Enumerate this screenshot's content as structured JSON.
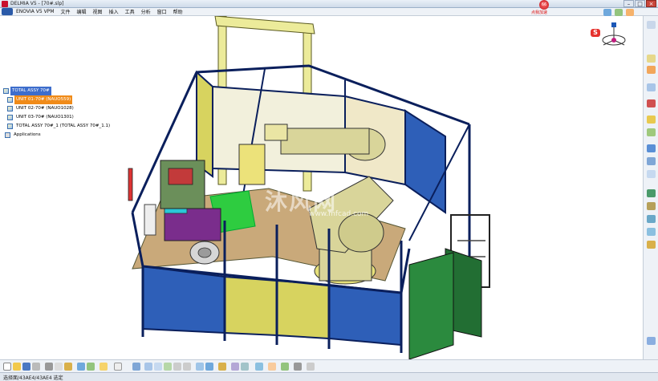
{
  "window": {
    "title": "DELMIA V5 - [70#.slp]"
  },
  "menu": [
    "ENOVIA V5 VPM",
    "文件",
    "编辑",
    "视图",
    "插入",
    "工具",
    "分析",
    "窗口",
    "帮助"
  ],
  "tree": [
    {
      "label": "TOTAL ASSY 70#",
      "style": "sel-blue"
    },
    {
      "label": "UNIT 01-70# (NAUO559)",
      "style": "sel-orange"
    },
    {
      "label": "UNIT 02-70# (NAUO1028)",
      "style": ""
    },
    {
      "label": "UNIT 03-70# (NAUO1301)",
      "style": ""
    },
    {
      "label": "TOTAL ASSY 70#_1 (TOTAL ASSY 70#_1.1)",
      "style": ""
    },
    {
      "label": "Applications",
      "style": ""
    }
  ],
  "watermark": {
    "text": "沐风网",
    "url": "www.mfcad.com"
  },
  "ad_badge": {
    "number": "66",
    "caption": "点我加速"
  },
  "s_logo": "S",
  "status": {
    "text": "选择面/43AE4/43AE4 选定"
  },
  "colors": {
    "accent_blue": "#3d6dcc",
    "accent_orange": "#f08b19",
    "frame_navy": "#0a1f5c",
    "panel_yellow": "#d7d35f",
    "panel_blue": "#2e5fb8",
    "robot_yellow": "#d9d59a",
    "cabinet_green": "#2b8a3e"
  }
}
